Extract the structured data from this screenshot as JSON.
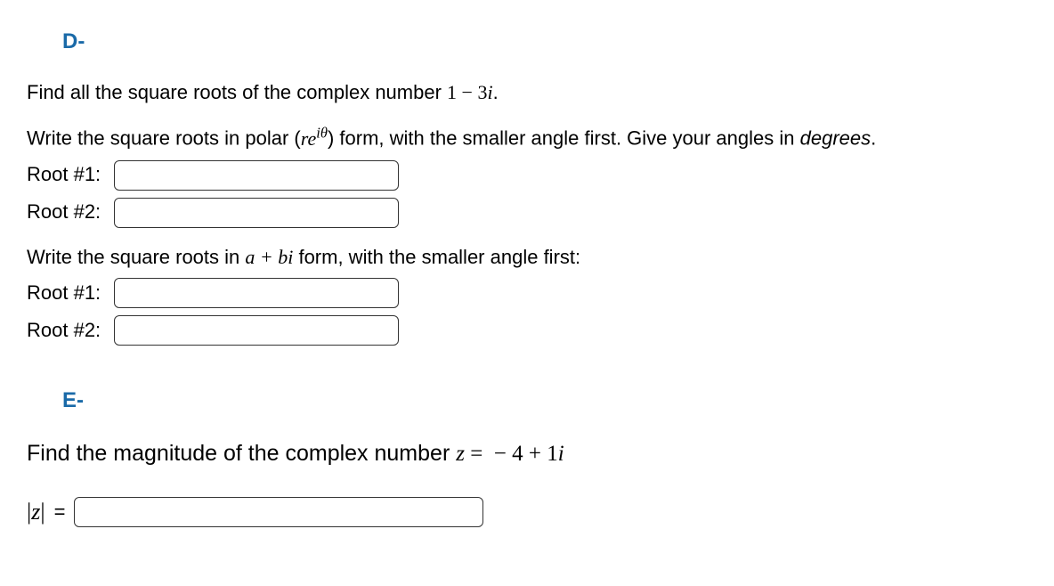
{
  "sectionD": {
    "label": "D-",
    "prompt_pre": "Find all the square roots of the complex number ",
    "complex": "1 − 3𝑖",
    "prompt_post": ".",
    "instruction_polar_pre": "Write the square roots in polar (",
    "polar_form": "re^{iθ}",
    "instruction_polar_post": ") form, with the smaller angle first. Give your angles in ",
    "degrees": "degrees",
    "instruction_abi_pre": "Write the square roots in ",
    "abi_form": "a + bi",
    "instruction_abi_post": " form, with the smaller angle first:",
    "root1_label": "Root #1:",
    "root2_label": "Root #2:"
  },
  "sectionE": {
    "label": "E-",
    "prompt_pre": "Find the magnitude of the complex number ",
    "z_eq": "z = ",
    "complex": " − 4 + 1𝑖",
    "modz": "|z|",
    "eq": "="
  }
}
